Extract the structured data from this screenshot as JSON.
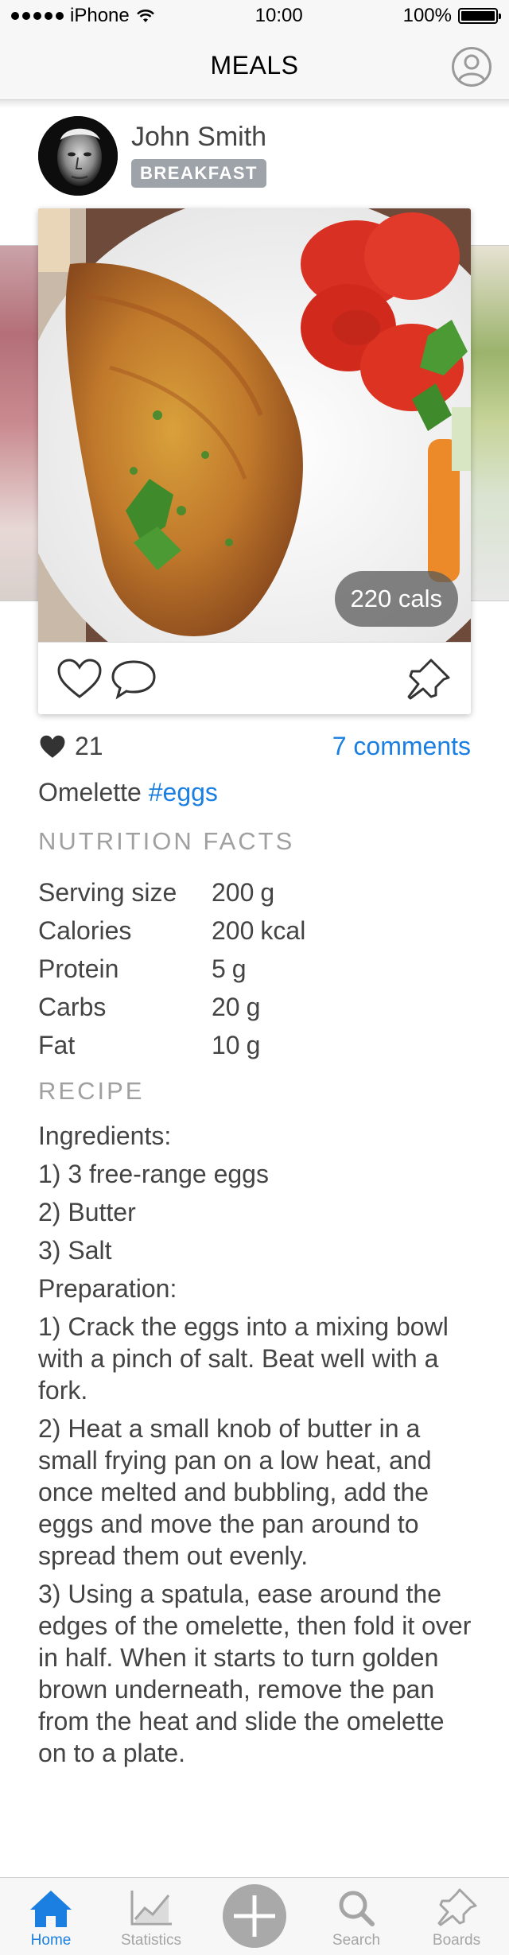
{
  "status_bar": {
    "carrier": "iPhone",
    "time": "10:00",
    "battery": "100%"
  },
  "nav": {
    "title": "MEALS"
  },
  "post": {
    "author": "John Smith",
    "meal_type": "BREAKFAST",
    "calories_pill": "220 cals",
    "likes_count": "21",
    "comments_link": "7 comments",
    "caption_text": "Omelette",
    "caption_hashtag": "#eggs"
  },
  "nutrition": {
    "header": "NUTRITION FACTS",
    "rows": [
      {
        "label": "Serving size",
        "amount": "200",
        "unit": "g"
      },
      {
        "label": "Calories",
        "amount": "200",
        "unit": "kcal"
      },
      {
        "label": "Protein",
        "amount": "5",
        "unit": "g"
      },
      {
        "label": "Carbs",
        "amount": "20",
        "unit": "g"
      },
      {
        "label": "Fat",
        "amount": "10",
        "unit": "g"
      }
    ]
  },
  "recipe": {
    "header": "RECIPE",
    "lines": [
      "Ingredients:",
      "1) 3 free-range eggs",
      "2) Butter",
      "3) Salt",
      "Preparation:",
      "1) Crack the eggs into a mixing bowl with a pinch of salt. Beat well with a fork.",
      "2) Heat a small knob of butter in a small frying pan on a low heat, and once melted and bubbling, add the eggs and move the pan around to spread them out evenly.",
      "3) Using a spatula, ease around the edges of the omelette, then fold it over in half. When it starts to turn golden brown underneath, remove the pan from the heat and slide the omelette on to a plate."
    ]
  },
  "tabs": [
    {
      "label": "Home",
      "icon": "home-icon",
      "active": true
    },
    {
      "label": "Statistics",
      "icon": "statistics-icon",
      "active": false
    },
    {
      "label": "",
      "icon": "add-icon",
      "active": false
    },
    {
      "label": "Search",
      "icon": "search-icon",
      "active": false
    },
    {
      "label": "Boards",
      "icon": "pin-icon",
      "active": false
    }
  ],
  "colors": {
    "accent": "#1a7fe0",
    "badge": "#9ea3a9",
    "muted": "#a0a0a0",
    "tab_inactive": "#a5a5a5"
  }
}
